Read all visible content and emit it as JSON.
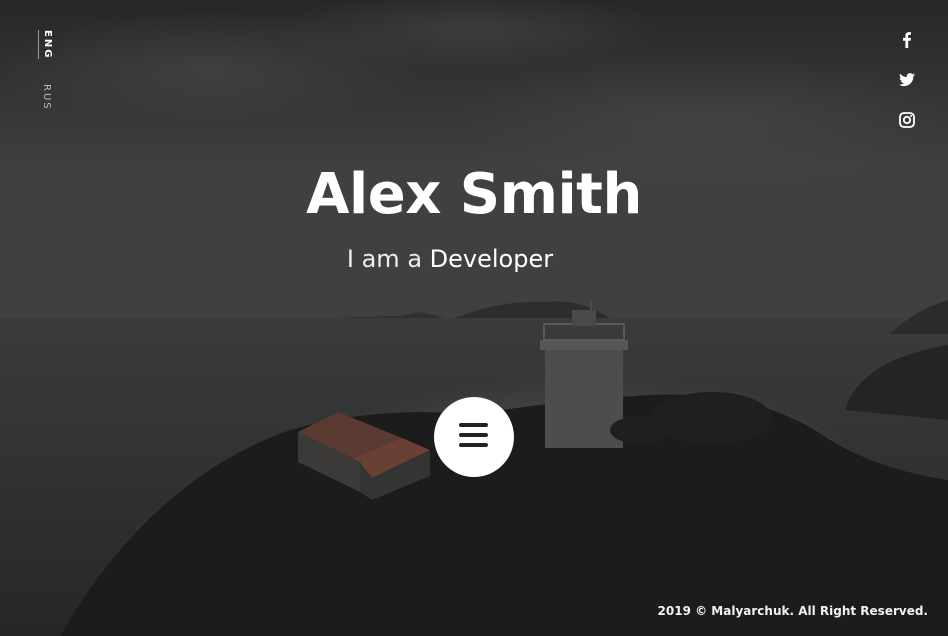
{
  "language_switcher": {
    "active": "ENG",
    "inactive": "RUS"
  },
  "social": [
    {
      "name": "facebook",
      "icon": "facebook-icon"
    },
    {
      "name": "twitter",
      "icon": "twitter-icon"
    },
    {
      "name": "instagram",
      "icon": "instagram-icon"
    }
  ],
  "hero": {
    "name": "Alex Smith",
    "prefix": "I am a",
    "role": "Developer"
  },
  "menu_button": {
    "icon": "hamburger-menu-icon"
  },
  "footer": {
    "copyright": "2019 © Malyarchuk. All Right Reserved."
  },
  "colors": {
    "overlay": "#1c1d1d",
    "text": "#ffffff",
    "menu_button_bg": "#ffffff",
    "menu_bars": "#222222"
  }
}
